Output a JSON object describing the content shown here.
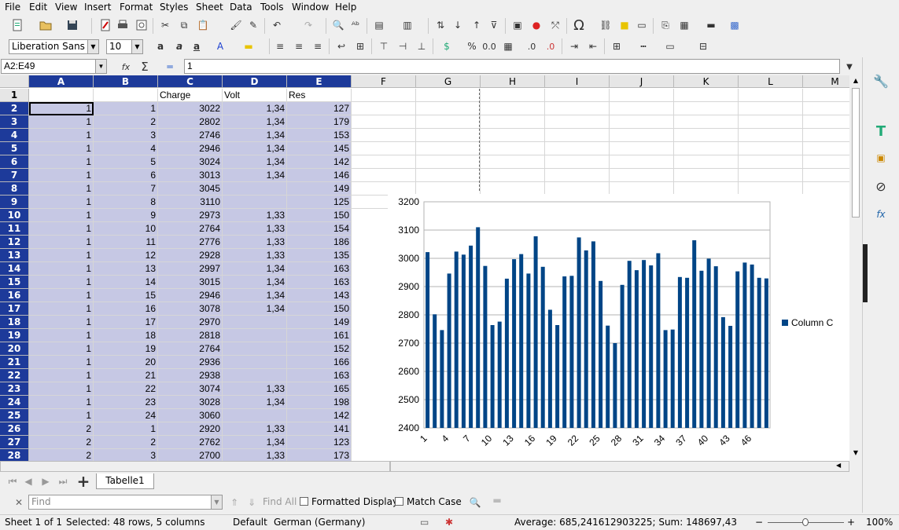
{
  "menu": [
    "File",
    "Edit",
    "View",
    "Insert",
    "Format",
    "Styles",
    "Sheet",
    "Data",
    "Tools",
    "Window",
    "Help"
  ],
  "formatting": {
    "font_name": "Liberation Sans",
    "font_size": "10"
  },
  "formula_bar": {
    "name_box": "A2:E49",
    "content": "1"
  },
  "columns": [
    "A",
    "B",
    "C",
    "D",
    "E",
    "F",
    "G",
    "H",
    "I",
    "J",
    "K",
    "L",
    "M"
  ],
  "header_row": [
    "",
    "",
    "Charge",
    "Volt",
    "Res"
  ],
  "rows": [
    [
      "1",
      "1",
      "3022",
      "1,34",
      "127"
    ],
    [
      "1",
      "2",
      "2802",
      "1,34",
      "179"
    ],
    [
      "1",
      "3",
      "2746",
      "1,34",
      "153"
    ],
    [
      "1",
      "4",
      "2946",
      "1,34",
      "145"
    ],
    [
      "1",
      "5",
      "3024",
      "1,34",
      "142"
    ],
    [
      "1",
      "6",
      "3013",
      "1,34",
      "146"
    ],
    [
      "1",
      "7",
      "3045",
      "",
      "149"
    ],
    [
      "1",
      "8",
      "3110",
      "",
      "125"
    ],
    [
      "1",
      "9",
      "2973",
      "1,33",
      "150"
    ],
    [
      "1",
      "10",
      "2764",
      "1,33",
      "154"
    ],
    [
      "1",
      "11",
      "2776",
      "1,33",
      "186"
    ],
    [
      "1",
      "12",
      "2928",
      "1,33",
      "135"
    ],
    [
      "1",
      "13",
      "2997",
      "1,34",
      "163"
    ],
    [
      "1",
      "14",
      "3015",
      "1,34",
      "163"
    ],
    [
      "1",
      "15",
      "2946",
      "1,34",
      "143"
    ],
    [
      "1",
      "16",
      "3078",
      "1,34",
      "150"
    ],
    [
      "1",
      "17",
      "2970",
      "",
      "149"
    ],
    [
      "1",
      "18",
      "2818",
      "",
      "161"
    ],
    [
      "1",
      "19",
      "2764",
      "",
      "152"
    ],
    [
      "1",
      "20",
      "2936",
      "",
      "166"
    ],
    [
      "1",
      "21",
      "2938",
      "",
      "163"
    ],
    [
      "1",
      "22",
      "3074",
      "1,33",
      "165"
    ],
    [
      "1",
      "23",
      "3028",
      "1,34",
      "198"
    ],
    [
      "1",
      "24",
      "3060",
      "",
      "142"
    ],
    [
      "2",
      "1",
      "2920",
      "1,33",
      "141"
    ],
    [
      "2",
      "2",
      "2762",
      "1,34",
      "123"
    ],
    [
      "2",
      "3",
      "2700",
      "1,33",
      "173"
    ]
  ],
  "chart_data": {
    "type": "bar",
    "categories": [
      "1",
      "2",
      "3",
      "4",
      "5",
      "6",
      "7",
      "8",
      "9",
      "10",
      "11",
      "12",
      "13",
      "14",
      "15",
      "16",
      "17",
      "18",
      "19",
      "20",
      "21",
      "22",
      "23",
      "24",
      "25",
      "26",
      "27",
      "28",
      "29",
      "30",
      "31",
      "32",
      "33",
      "34",
      "35",
      "36",
      "37",
      "38",
      "39",
      "40",
      "41",
      "42",
      "43",
      "44",
      "45",
      "46",
      "47",
      "48"
    ],
    "x_tick_labels": [
      "1",
      "4",
      "7",
      "10",
      "13",
      "16",
      "19",
      "22",
      "25",
      "28",
      "31",
      "34",
      "37",
      "40",
      "43",
      "46"
    ],
    "series": [
      {
        "name": "Column C",
        "color": "#004586",
        "values": [
          3022,
          2802,
          2746,
          2946,
          3024,
          3013,
          3045,
          3110,
          2973,
          2764,
          2776,
          2928,
          2997,
          3015,
          2946,
          3078,
          2970,
          2818,
          2764,
          2936,
          2938,
          3074,
          3028,
          3060,
          2920,
          2762,
          2700,
          2906,
          2991,
          2958,
          2994,
          2975,
          3018,
          2746,
          2748,
          2934,
          2931,
          3064,
          2956,
          2999,
          2972,
          2792,
          2761,
          2954,
          2985,
          2978,
          2931,
          2929
        ]
      }
    ],
    "ylim": [
      2400,
      3200
    ],
    "y_ticks": [
      "3200",
      "3100",
      "3000",
      "2900",
      "2800",
      "2700",
      "2600",
      "2500",
      "2400"
    ],
    "grid": true,
    "legend": "right"
  },
  "sheet_tabs": [
    "Tabelle1"
  ],
  "find": {
    "placeholder": "Find",
    "find_all": "Find All",
    "formatted_display": "Formatted Display",
    "match_case": "Match Case"
  },
  "status": {
    "sheet": "Sheet 1 of 1",
    "selection": "Selected: 48 rows, 5 columns",
    "style": "Default",
    "language": "German (Germany)",
    "summary": "Average: 685,241612903225; Sum: 148697,43",
    "zoom": "100%"
  }
}
